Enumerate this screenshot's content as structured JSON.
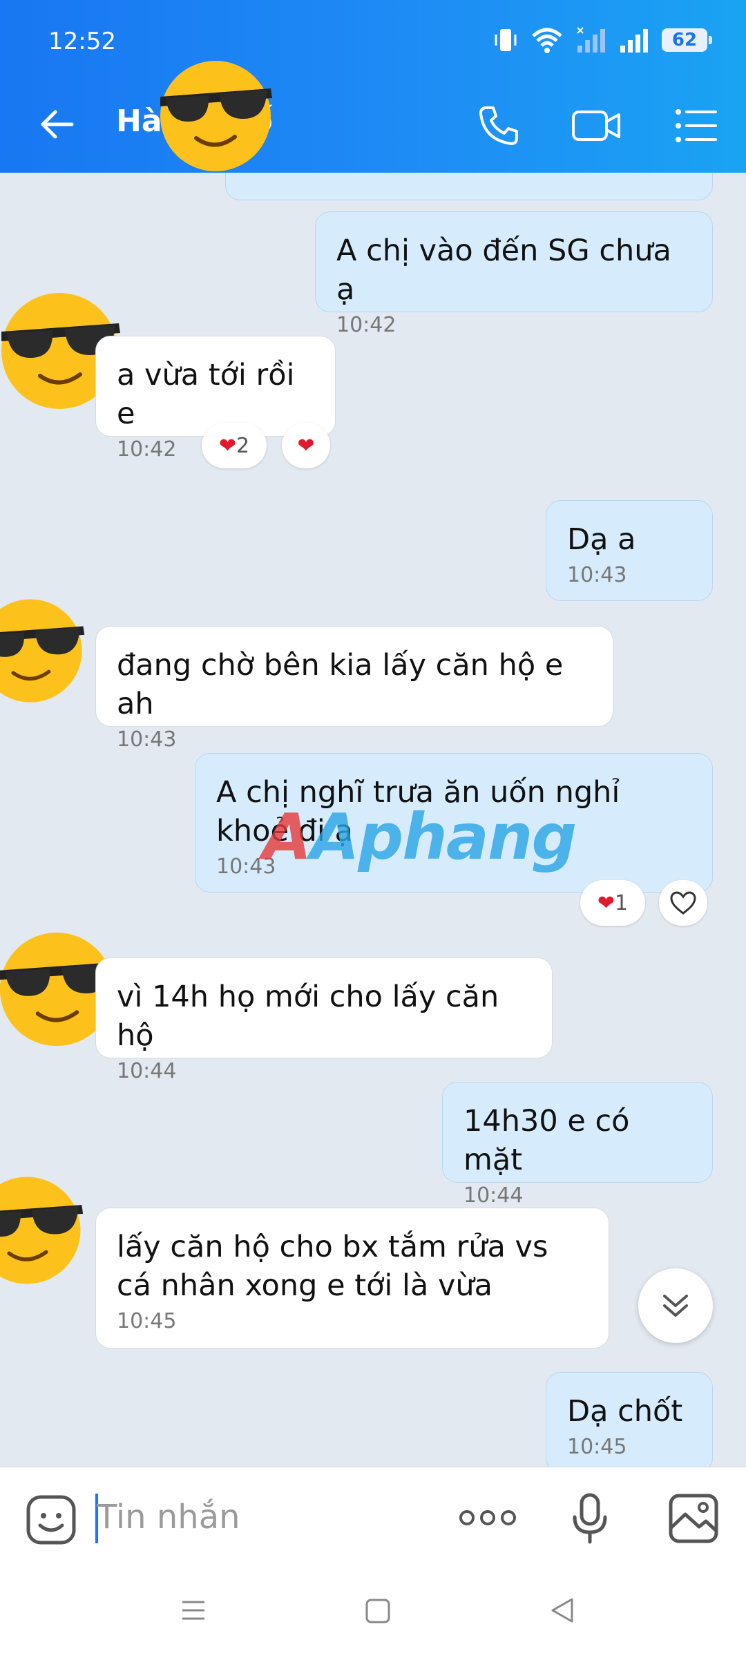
{
  "status_bar": {
    "time": "12:52",
    "battery": "62"
  },
  "header": {
    "title": "Hà",
    "title_tail": "ố"
  },
  "messages": [
    {
      "dir": "out",
      "text": "A chị vào đến SG chưa ạ",
      "time": "10:42"
    },
    {
      "dir": "in",
      "text": "a vừa tới rồi e",
      "time": "10:42",
      "reactions": [
        "2"
      ]
    },
    {
      "dir": "out",
      "text": "Dạ a",
      "time": "10:43"
    },
    {
      "dir": "in",
      "text": "đang chờ bên kia lấy căn hộ e ah",
      "time": "10:43"
    },
    {
      "dir": "out",
      "text": "A chị nghĩ trưa ăn uốn nghỉ khoẻ đi ạ",
      "time": "10:43",
      "reactions": [
        "1"
      ]
    },
    {
      "dir": "in",
      "text": "vì 14h họ mới cho lấy căn hộ",
      "time": "10:44"
    },
    {
      "dir": "out",
      "text": "14h30 e có mặt",
      "time": "10:44"
    },
    {
      "dir": "in",
      "text": "lấy căn hộ cho bx tắm rửa vs cá nhân xong e tới là vừa",
      "time": "10:45"
    },
    {
      "dir": "out",
      "text": "Dạ chốt",
      "time": "10:45"
    }
  ],
  "watermark": "Aphang",
  "input": {
    "placeholder": "Tin nhắn"
  },
  "colors": {
    "header": "#1877f2",
    "outgoing_bubble": "#d6ecfd",
    "incoming_bubble": "#ffffff",
    "background": "#e2e9f1"
  }
}
